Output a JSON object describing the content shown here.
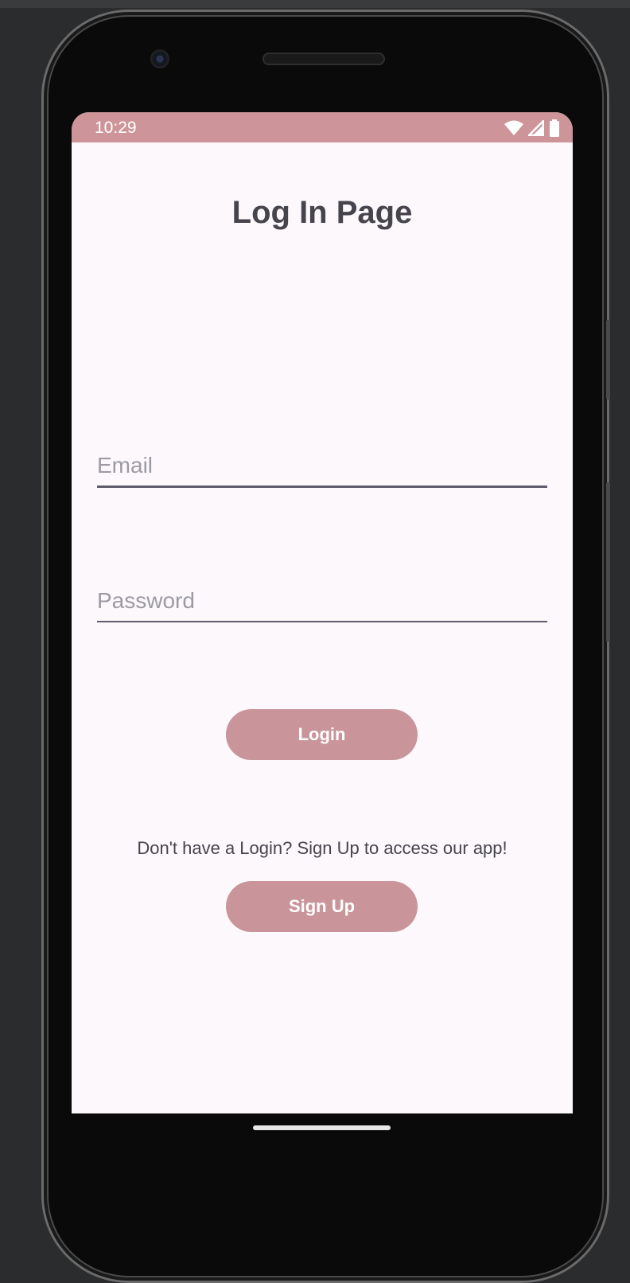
{
  "status_bar": {
    "time": "10:29",
    "icons": [
      "wifi-icon",
      "cellular-signal-icon",
      "battery-icon"
    ],
    "color": "#cd959a"
  },
  "page": {
    "title": "Log In Page"
  },
  "form": {
    "email_placeholder": "Email",
    "password_placeholder": "Password",
    "login_label": "Login",
    "signup_hint": "Don't have a Login? Sign Up to access our app!",
    "signup_label": "Sign Up"
  },
  "colors": {
    "accent": "#c9959a",
    "background": "#fcf8fc",
    "text": "#46454d"
  }
}
